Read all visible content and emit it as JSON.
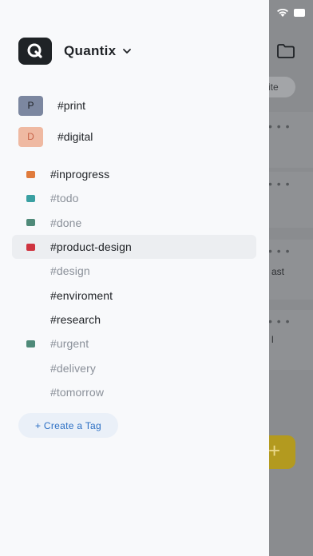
{
  "app": {
    "name": "Quantix"
  },
  "background": {
    "pill_label": "ite",
    "card_texts": [
      "ast",
      "l"
    ],
    "fab_label": "+"
  },
  "workspaces": [
    {
      "initial": "P",
      "label": "#print",
      "avatar_bg": "#7c87a0",
      "avatar_fg": "#1e2125"
    },
    {
      "initial": "D",
      "label": "#digital",
      "avatar_bg": "#efb9a2",
      "avatar_fg": "#c8654a"
    }
  ],
  "tags": [
    {
      "label": "#inprogress",
      "color": "#e07b3c",
      "text_color": "#1e2125",
      "active": false
    },
    {
      "label": "#todo",
      "color": "#3aa0a2",
      "text_color": "#8a9099",
      "active": false
    },
    {
      "label": "#done",
      "color": "#4f8a79",
      "text_color": "#8a9099",
      "active": false
    },
    {
      "label": "#product-design",
      "color": "#cf3440",
      "text_color": "#1e2125",
      "active": true
    },
    {
      "label": "#design",
      "color": "",
      "text_color": "#8a9099",
      "active": false
    },
    {
      "label": "#enviroment",
      "color": "",
      "text_color": "#1e2125",
      "active": false
    },
    {
      "label": "#research",
      "color": "",
      "text_color": "#1e2125",
      "active": false
    },
    {
      "label": "#urgent",
      "color": "#4f8a79",
      "text_color": "#8a9099",
      "active": false
    },
    {
      "label": "#delivery",
      "color": "",
      "text_color": "#8a9099",
      "active": false
    },
    {
      "label": "#tomorrow",
      "color": "",
      "text_color": "#8a9099",
      "active": false
    }
  ],
  "create_tag_label": "+ Create a Tag"
}
